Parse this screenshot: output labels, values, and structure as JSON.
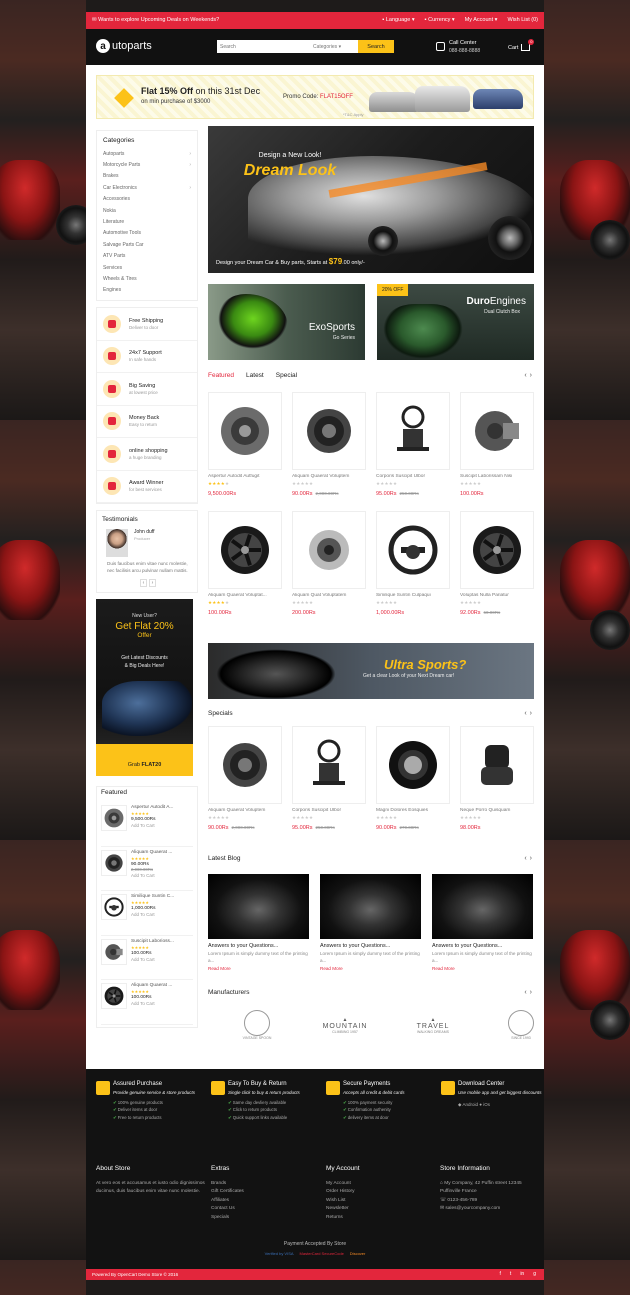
{
  "topbar": {
    "promo": "Wants to explore Upcoming Deals on Weekends?",
    "language": "Language",
    "currency": "Currency",
    "account": "My Account",
    "wishlist": "Wish List (0)"
  },
  "header": {
    "logo_letter": "a",
    "logo_text": "utoparts",
    "search_placeholder": "Search",
    "categories": "Categories",
    "search_button": "Search",
    "call_label": "Call Center",
    "call_number": "088-888-8888",
    "cart": "Cart",
    "cart_count": "0"
  },
  "offer": {
    "title_a": "Flat 15% Off",
    "title_b": "on this 31st Dec",
    "subtitle": "on min purchase of $3000",
    "promo_label": "Promo Code:",
    "promo_code": "FLAT15OFF",
    "tc": "*T&C Apply"
  },
  "categories": {
    "title": "Categories",
    "items": [
      {
        "label": "Autoparts",
        "chevron": true
      },
      {
        "label": "Motorcycle Parts",
        "chevron": true
      },
      {
        "label": "Brakes",
        "chevron": false
      },
      {
        "label": "Car Electronics",
        "chevron": true
      },
      {
        "label": "Accessories",
        "chevron": false
      },
      {
        "label": "Nokia",
        "chevron": false
      },
      {
        "label": "Literature",
        "chevron": false
      },
      {
        "label": "Automotive Tools",
        "chevron": false
      },
      {
        "label": "Salvage Parts Car",
        "chevron": false
      },
      {
        "label": "ATV Parts",
        "chevron": false
      },
      {
        "label": "Services",
        "chevron": false
      },
      {
        "label": "Wheels & Tires",
        "chevron": false
      },
      {
        "label": "Engines",
        "chevron": false
      }
    ]
  },
  "features": [
    {
      "title": "Free Shipping",
      "sub": "Deliver to door"
    },
    {
      "title": "24x7 Support",
      "sub": "In safe hands"
    },
    {
      "title": "Big Saving",
      "sub": "at lowest price"
    },
    {
      "title": "Money Back",
      "sub": "Easy to return"
    },
    {
      "title": "online shopping",
      "sub": "a huge branding"
    },
    {
      "title": "Award Winner",
      "sub": "for best services"
    }
  ],
  "testimonials": {
    "title": "Testimonials",
    "name": "John duff",
    "role": "Producer",
    "text": "Duis faucibus enim vitae nunc molestie, nec facilisis arcu pulvinar nullam mattis."
  },
  "ad": {
    "l1": "New User?",
    "l2": "Get Flat 20%",
    "l3": "Offer",
    "l4a": "Get Latest Discounts",
    "l4b": "& Big Deals Here!",
    "grab": "Grab ",
    "code": "FLAT20"
  },
  "featured": {
    "title": "Featured",
    "items": [
      {
        "name": "Aspertur Autodit A...",
        "stars": 4,
        "price": "9,500.00Rs",
        "old": "",
        "add": "Add To Cart"
      },
      {
        "name": "Aliquam Quaerat ...",
        "stars": 0,
        "price": "90.00Rs",
        "old": "2,000.00Rs",
        "add": "Add To Cart"
      },
      {
        "name": "Similique Suntin C...",
        "stars": 0,
        "price": "1,000.00Rs",
        "old": "",
        "add": "Add To Cart"
      },
      {
        "name": "Suscipit Laborioss...",
        "stars": 0,
        "price": "100.00Rs",
        "old": "",
        "add": "Add To Cart"
      },
      {
        "name": "Aliquam Quaerat ...",
        "stars": 4,
        "price": "100.00Rs",
        "old": "",
        "add": "Add To Cart"
      }
    ]
  },
  "hero": {
    "line1": "Design a New Look!",
    "line2": "Dream Look",
    "line3": "Design your Dream Car & Buy parts, Starts at ",
    "price": "$79",
    "suffix": ".00 only/-"
  },
  "exo": {
    "title_a": "Exo",
    "title_b": "Sports",
    "sub": "Go Series"
  },
  "duro": {
    "badge": "20% OFF",
    "title_a": "Duro",
    "title_b": "Engines",
    "sub": "Dual Clutch Box"
  },
  "tabs": [
    "Featured",
    "Latest",
    "Special"
  ],
  "products": [
    {
      "name": "Aspertur Autodit Autfugit",
      "stars": 4,
      "price": "9,500.00Rs",
      "old": "",
      "img": "disc"
    },
    {
      "name": "Aliquam Quaerat Voluptem",
      "stars": 0,
      "price": "90.00Rs",
      "old": "2,000.00Rs",
      "img": "drum"
    },
    {
      "name": "Corporis Suscipit Ulbor",
      "stars": 0,
      "price": "95.00Rs",
      "old": "250.00Rs",
      "img": "rig"
    },
    {
      "name": "Suscipit Laborissam Nisi",
      "stars": 0,
      "price": "100.00Rs",
      "old": "",
      "img": "motor"
    },
    {
      "name": "Aliquam Quaerat Voluptat...",
      "stars": 4,
      "price": "100.00Rs",
      "old": "",
      "img": "wheel"
    },
    {
      "name": "Aliquam Quat Voluptatem",
      "stars": 0,
      "price": "200.00Rs",
      "old": "",
      "img": "alternator"
    },
    {
      "name": "Similique Suntin Culpaqui",
      "stars": 0,
      "price": "1,000.00Rs",
      "old": "",
      "img": "steer"
    },
    {
      "name": "Voluptas Nulla Pariatur",
      "stars": 0,
      "price": "92.00Rs",
      "old": "60.00Rs",
      "img": "wheel"
    }
  ],
  "ultra": {
    "title": "Ultra Sports?",
    "sub": "Get a clear Look of your Next Dream car!"
  },
  "specials_title": "Specials",
  "specials": [
    {
      "name": "Aliquam Quaerat Voluptem",
      "stars": 0,
      "price": "90.00Rs",
      "old": "2,000.00Rs",
      "img": "drum"
    },
    {
      "name": "Corporis Suscipit Ulbor",
      "stars": 0,
      "price": "95.00Rs",
      "old": "250.00Rs",
      "img": "rig"
    },
    {
      "name": "Magni Dolores Eosquies",
      "stars": 0,
      "price": "90.00Rs",
      "old": "270.00Rs",
      "img": "tire"
    },
    {
      "name": "Neque Porro Quisquam",
      "stars": 0,
      "price": "98.00Rs",
      "old": "",
      "img": "seat"
    }
  ],
  "blog_title": "Latest Blog",
  "blogs": [
    {
      "title": "Answers to your Questions...",
      "text": "Lorem Ipsum is simply dummy text of the printing a...",
      "more": "Read More"
    },
    {
      "title": "Answers to your Questions...",
      "text": "Lorem Ipsum is simply dummy text of the printing a...",
      "more": "Read More"
    },
    {
      "title": "Answers to your Questions...",
      "text": "Lorem Ipsum is simply dummy text of the printing a...",
      "more": "Read More"
    }
  ],
  "manufacturers_title": "Manufacturers",
  "manufacturers": [
    {
      "name": "",
      "sub": "VINTAGE SPOON"
    },
    {
      "name": "MOUNTAIN",
      "sub": "CLIMBING 1957"
    },
    {
      "name": "TRAVEL",
      "sub": "WALKING DREAMS"
    },
    {
      "name": "",
      "sub": "SINCE 1993"
    }
  ],
  "footer_top": [
    {
      "title": "Assured Purchase",
      "sub": "Provide genuine service & store products",
      "items": [
        "100% genuine products",
        "Deliver items at door",
        "Free to return products"
      ]
    },
    {
      "title": "Easy To Buy & Return",
      "sub": "Single click to buy & return products",
      "items": [
        "Same day devliery available",
        "Click to return products",
        "Quick support links available"
      ]
    },
    {
      "title": "Secure Payments",
      "sub": "Accepts all credit & debit cards",
      "items": [
        "100% payment security",
        "Confirmation authenity",
        "delivery items at door"
      ]
    },
    {
      "title": "Download Center",
      "sub": "Use mobile app and get biggest discounts",
      "android": "Android",
      "ios": "iOs"
    }
  ],
  "footer_about": {
    "title": "About Store",
    "text": "At vero eos et accusamus et iusto odio dignissimos ducimus, duis faucibus enim vitae nunc molestie."
  },
  "footer_extras": {
    "title": "Extras",
    "items": [
      "Brands",
      "Gift Certificates",
      "Affiliates",
      "Contact Us",
      "Specials"
    ]
  },
  "footer_account": {
    "title": "My Account",
    "items": [
      "My Account",
      "Order History",
      "Wish List",
      "Newsletter",
      "Returns"
    ]
  },
  "footer_store": {
    "title": "Store Information",
    "address": "My Company, 42 Puffin street 12345 Puffinville France",
    "phone": "0123-456-789",
    "email": "sales@yourcompany.com"
  },
  "payment": {
    "title": "Payment Accepted By Store",
    "logos": [
      "Verified by VISA",
      "MasterCard SecureCode",
      "Discover"
    ]
  },
  "copyright": "Powered By OpenCart Demo Store © 2016",
  "social": [
    "f",
    "t",
    "in",
    "g"
  ],
  "colors": {
    "accent": "#e3263c",
    "yellow": "#fcc218",
    "dark": "#111111"
  }
}
